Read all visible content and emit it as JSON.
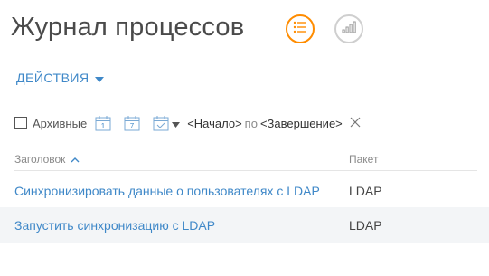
{
  "header": {
    "title": "Журнал процессов"
  },
  "toolbar": {
    "actions_label": "ДЕЙСТВИЯ"
  },
  "filters": {
    "archive_label": "Архивные",
    "calendar_day": "1",
    "calendar_week": "7",
    "period_start": "<Начало>",
    "period_separator": "по",
    "period_end": "<Завершение>"
  },
  "table": {
    "columns": [
      "Заголовок",
      "Пакет"
    ],
    "rows": [
      {
        "title": "Синхронизировать данные о пользователях с LDAP",
        "package": "LDAP"
      },
      {
        "title": "Запустить синхронизацию с LDAP",
        "package": "LDAP"
      }
    ]
  },
  "colors": {
    "accent": "#ff8c00",
    "link": "#3f88c8"
  },
  "icons": {
    "list_view": "list-icon",
    "chart_view": "bar-chart-icon",
    "actions_dropdown": "caret-down-icon",
    "calendar": "calendar-icon",
    "clear": "close-icon",
    "sort": "chevron-up-icon"
  }
}
